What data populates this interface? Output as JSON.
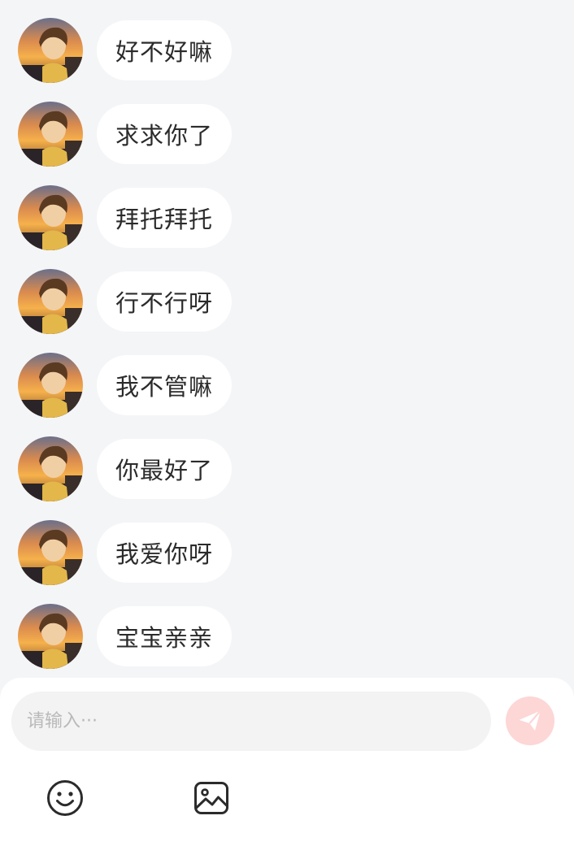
{
  "messages": [
    {
      "text": "好不好嘛"
    },
    {
      "text": "求求你了"
    },
    {
      "text": "拜托拜托"
    },
    {
      "text": "行不行呀"
    },
    {
      "text": "我不管嘛"
    },
    {
      "text": "你最好了"
    },
    {
      "text": "我爱你呀"
    },
    {
      "text": "宝宝亲亲"
    }
  ],
  "input": {
    "placeholder": "请输入···",
    "value": ""
  },
  "toolbar": {
    "send_icon": "paper-plane-icon",
    "emoji_icon": "smiley-face-icon",
    "image_icon": "image-icon"
  },
  "colors": {
    "background": "#f4f5f7",
    "bubble": "#ffffff",
    "send_button": "#fdd6d6",
    "send_icon": "#ffffff",
    "toolbar_icon": "#2b2b2b"
  }
}
